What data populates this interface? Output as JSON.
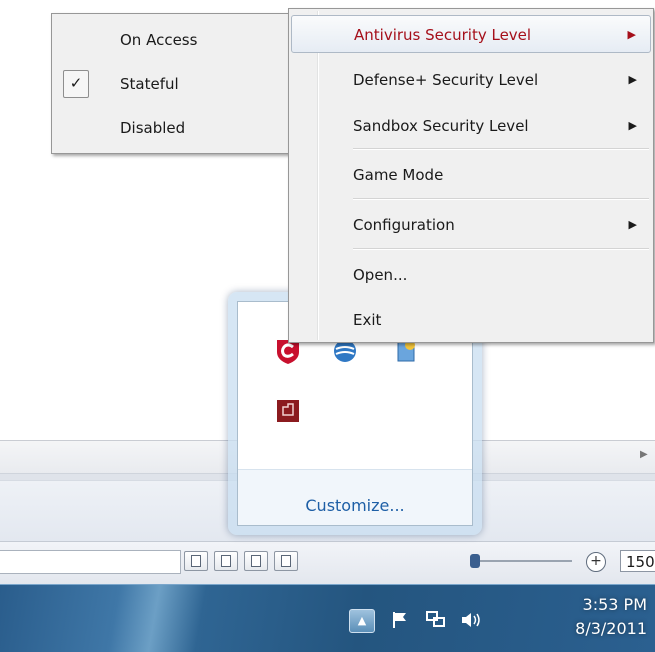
{
  "main_menu": {
    "items": [
      {
        "label": "Antivirus Security Level",
        "has_submenu": true
      },
      {
        "label": "Defense+ Security Level",
        "has_submenu": true
      },
      {
        "label": "Sandbox Security Level",
        "has_submenu": true
      },
      {
        "label": "Game Mode",
        "has_submenu": false
      },
      {
        "label": "Configuration",
        "has_submenu": true
      },
      {
        "label": "Open...",
        "has_submenu": false
      },
      {
        "label": "Exit",
        "has_submenu": false
      }
    ],
    "highlight_color": "#a50f1a"
  },
  "submenu": {
    "items": [
      {
        "label": "On Access",
        "checked": false
      },
      {
        "label": "Stateful",
        "checked": true
      },
      {
        "label": "Disabled",
        "checked": false
      }
    ],
    "check_glyph": "✓"
  },
  "flyout": {
    "customize_label": "Customize...",
    "icons": [
      "comodo-antivirus-icon",
      "network-globe-icon",
      "internet-explorer-icon",
      "comodo-firewall-icon"
    ]
  },
  "statusbar": {
    "zoom_value": "150"
  },
  "taskbar": {
    "time": "3:53 PM",
    "date": "8/3/2011",
    "show_hidden_glyph": "▲",
    "accent": "#2b6090"
  }
}
